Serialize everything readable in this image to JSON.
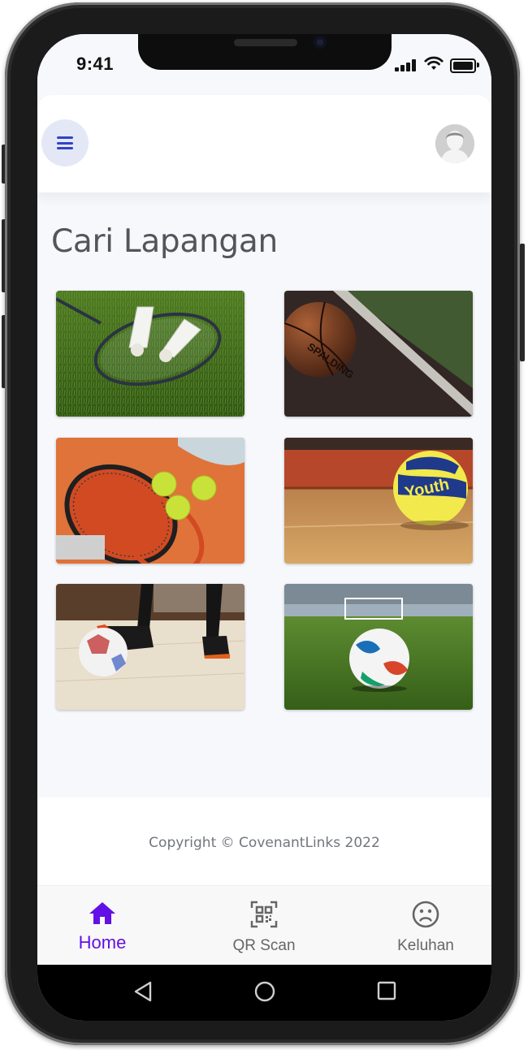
{
  "status_bar": {
    "time": "9:41"
  },
  "header": {
    "menu_icon": "hamburger-icon",
    "avatar_icon": "user-avatar-icon"
  },
  "page": {
    "title": "Cari Lapangan"
  },
  "fields": [
    {
      "name": "badminton",
      "icon": "badminton-image"
    },
    {
      "name": "basketball",
      "icon": "basketball-image"
    },
    {
      "name": "tennis",
      "icon": "tennis-image"
    },
    {
      "name": "volleyball",
      "icon": "volleyball-image"
    },
    {
      "name": "futsal",
      "icon": "futsal-image"
    },
    {
      "name": "football",
      "icon": "football-image"
    }
  ],
  "footer": {
    "copyright": "Copyright © CovenantLinks 2022"
  },
  "bottom_nav": {
    "items": [
      {
        "label": "Home",
        "icon": "home-icon",
        "active": true
      },
      {
        "label": "QR Scan",
        "icon": "qr-code-icon",
        "active": false
      },
      {
        "label": "Keluhan",
        "icon": "sad-face-icon",
        "active": false
      }
    ]
  },
  "colors": {
    "accent": "#6210e6",
    "menu_icon": "#2f43c9",
    "title": "#51565c"
  }
}
